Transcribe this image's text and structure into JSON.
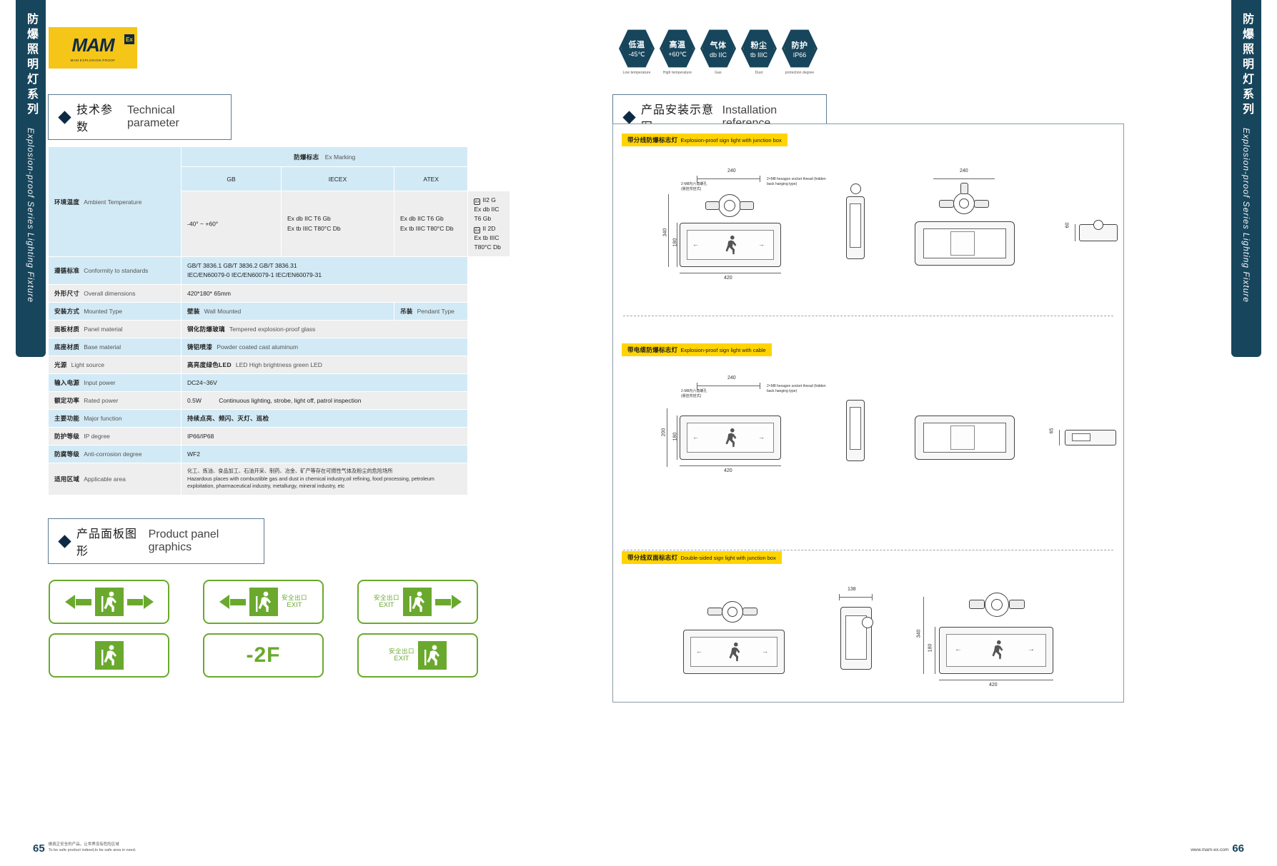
{
  "side_tab": {
    "cn": "防爆照明灯系列",
    "en": "Explosion-proof Series Lighting Fixture"
  },
  "logo": {
    "mark": "MAM",
    "sub": "MAM  EXPLOSION-PROOF",
    "ex": "Ex"
  },
  "sections": {
    "tech_param": {
      "cn": "技术参数",
      "en": "Technical parameter"
    },
    "panel_graphics": {
      "cn": "产品面板图形",
      "en": "Product panel graphics"
    },
    "installation": {
      "cn": "产品安装示意图",
      "en": "Installation reference"
    }
  },
  "badges": [
    {
      "cn": "低温",
      "value": "-45℃",
      "caption": "Low temperature"
    },
    {
      "cn": "高温",
      "value": "+60℃",
      "caption": "High temperature"
    },
    {
      "cn": "气体",
      "value": "db IIC",
      "caption": "Gas"
    },
    {
      "cn": "粉尘",
      "value": "tb IIIC",
      "caption": "Dust"
    },
    {
      "cn": "防护",
      "value": "IP66",
      "caption": "protection degree"
    }
  ],
  "table": {
    "ex_marking_header": {
      "cn": "防爆标志",
      "en": "Ex Marking"
    },
    "standards_columns": [
      "GB",
      "IECEX",
      "ATEX"
    ],
    "rows": [
      {
        "label_cn": "环境温度",
        "label_en": "Ambient Temperature",
        "value": "-40° ~ +60°",
        "gb": [
          "Ex db IIC T6 Gb",
          "Ex tb IIIC T80°C Db"
        ],
        "iecex": [
          "Ex db IIC T6 Gb",
          "Ex tb IIIC T80°C Db"
        ],
        "atex": [
          "II2 G Ex db IIC T6 Gb",
          "II 2D Ex tb IIIC T80°C Db"
        ]
      },
      {
        "label_cn": "遵循标准",
        "label_en": "Conformity to standards",
        "value_lines": [
          "GB/T 3836.1     GB/T 3836.2     GB/T 3836.31",
          "IEC/EN60079-0 IEC/EN60079-1 IEC/EN60079-31"
        ]
      },
      {
        "label_cn": "外形尺寸",
        "label_en": "Overall dimensions",
        "value": "420*180* 65mm"
      },
      {
        "label_cn": "安装方式",
        "label_en": "Mounted Type",
        "value_cn": "壁装",
        "value_en": "Wall Mounted",
        "value2_cn": "吊装",
        "value2_en": "Pendant Type"
      },
      {
        "label_cn": "面板材质",
        "label_en": "Panel material",
        "value_cn": "钢化防爆玻璃",
        "value_en": "Tempered explosion-proof glass"
      },
      {
        "label_cn": "底座材质",
        "label_en": "Base material",
        "value_cn": "铸铝喷漆",
        "value_en": "Powder coated cast aluminum"
      },
      {
        "label_cn": "光源",
        "label_en": "Light source",
        "value_cn": "高亮度绿色LED",
        "value_en": "LED High brightness green LED"
      },
      {
        "label_cn": "输入电源",
        "label_en": "Input power",
        "value": "DC24~36V"
      },
      {
        "label_cn": "额定功率",
        "label_en": "Rated power",
        "value_cn": "0.5W",
        "value_en": "Continuous lighting, strobe, light off, patrol inspection"
      },
      {
        "label_cn": "主要功能",
        "label_en": "Major function",
        "value_cn": "持续点亮、频闪、灭灯、巡检"
      },
      {
        "label_cn": "防护等级",
        "label_en": "IP degree",
        "value": "IP66/IP68"
      },
      {
        "label_cn": "防腐等级",
        "label_en": "Anti-corrosion degree",
        "value": "WF2"
      },
      {
        "label_cn": "适用区域",
        "label_en": "Applicable area",
        "value_cn": "化工、炼油、食品加工、石油开采、制药、冶金、矿产等存在可燃性气体及粉尘的危险场所",
        "value_en": "Hazardous places with combustible gas and dust in chemical industry,oil refining, food processing, petroleum exploitation, pharmaceutical industry, metallurgy, mineral industry, etc"
      }
    ]
  },
  "panels": [
    {
      "type": "arrows-both",
      "left_arrow": true,
      "right_arrow": true,
      "text": ""
    },
    {
      "type": "arrow-left-text",
      "cn": "安全出口",
      "en": "EXIT"
    },
    {
      "type": "text-arrow-right",
      "cn": "安全出口",
      "en": "EXIT"
    },
    {
      "type": "man-only",
      "text": ""
    },
    {
      "type": "floor",
      "text": "-2F"
    },
    {
      "type": "text-man",
      "cn": "安全出口",
      "en": "EXIT"
    }
  ],
  "install_labels": [
    {
      "cn": "带分线防爆标志灯",
      "en": "Explosion-proof sign light with junction box"
    },
    {
      "cn": "带电缆防爆标志灯",
      "en": "Explosion-proof sign light with cable"
    },
    {
      "cn": "带分线双面标志灯",
      "en": "Double-sided sign light with junction box"
    }
  ],
  "dimensions": {
    "d1": {
      "top": "240",
      "left": "340",
      "inner": "180",
      "bottom": "420",
      "side_top": "240",
      "side_depth": "60",
      "note_cn": "2-M8内六角螺孔",
      "note_cn2": "(悬挂背挂式)",
      "note_en": "2×M8 hexagon socket thread (hidden",
      "note_en2": "back hanging type)"
    },
    "d2": {
      "top": "240",
      "left": "200",
      "inner": "180",
      "bottom": "420",
      "side_depth": "65",
      "note_cn": "2-M8内六角螺孔",
      "note_cn2": "(悬挂背挂式)",
      "note_en": "2×M8 hexagon socket thread (hidden",
      "note_en2": "back hanging type)"
    },
    "d3": {
      "width": "138",
      "right_outer": "340",
      "right_inner": "180",
      "bottom": "420"
    }
  },
  "footer": {
    "page_left": "65",
    "slogan_cn": "做真正安全的产品，让世界没有危险区域",
    "slogan_en": "To be safe product indeed,to be safe area in need.",
    "website": "www.mam-ex.com",
    "page_right": "66"
  }
}
